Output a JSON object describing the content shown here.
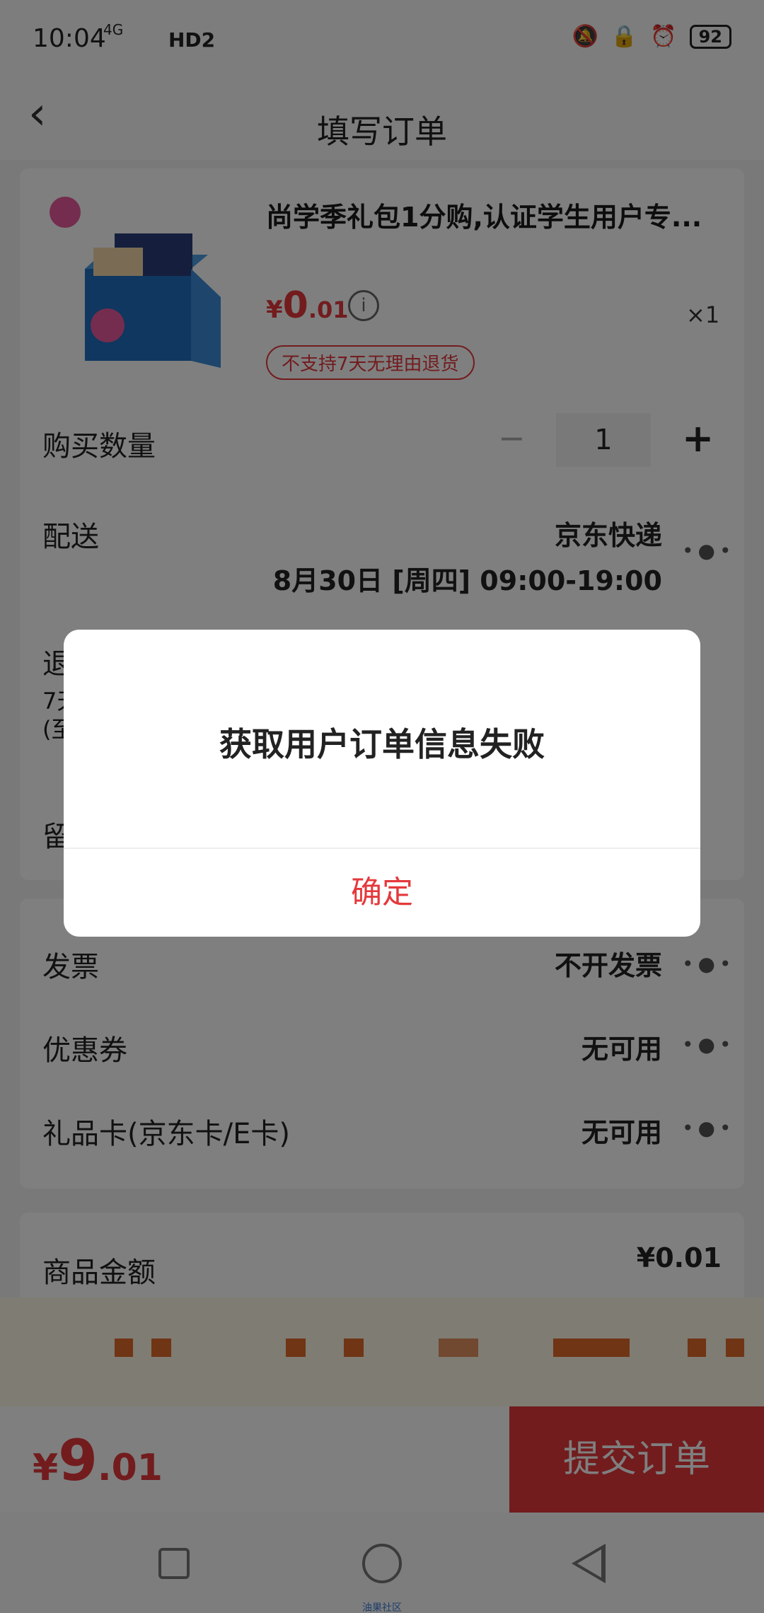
{
  "status_bar": {
    "time": "10:04",
    "network": "4G",
    "hd": "HD2",
    "battery": "92"
  },
  "header": {
    "title": "填写订单"
  },
  "product": {
    "name": "尚学季礼包1分购,认证学生用户专...",
    "price_symbol": "¥",
    "price_main": "0",
    "price_decimal": ".01",
    "quantity_badge": "×1",
    "return_tag": "不支持7天无理由退货"
  },
  "quantity_row": {
    "label": "购买数量",
    "value": "1",
    "minus": "−",
    "plus": "+"
  },
  "delivery_row": {
    "label": "配送",
    "method": "京东快递",
    "time": "8月30日 [周四] 09:00-19:00"
  },
  "return_row": {
    "label_partial": "退",
    "line2_partial": "7天",
    "line3_partial": "(至"
  },
  "message_row": {
    "label_partial": "留"
  },
  "invoice_row": {
    "label": "发票",
    "value": "不开发票"
  },
  "coupon_row": {
    "label": "优惠券",
    "value": "无可用"
  },
  "giftcard_row": {
    "label": "礼品卡(京东卡/E卡)",
    "value": "无可用"
  },
  "amount_row": {
    "label": "商品金额",
    "value": "¥0.01"
  },
  "bottom_bar": {
    "total_symbol": "¥",
    "total_main": "9",
    "total_decimal": ".01",
    "submit_label": "提交订单"
  },
  "dialog": {
    "message": "获取用户订单信息失败",
    "confirm_label": "确定"
  },
  "watermark": "油果社区",
  "colors": {
    "accent": "#e4393c",
    "overlay": "rgba(0,0,0,0.5)"
  }
}
